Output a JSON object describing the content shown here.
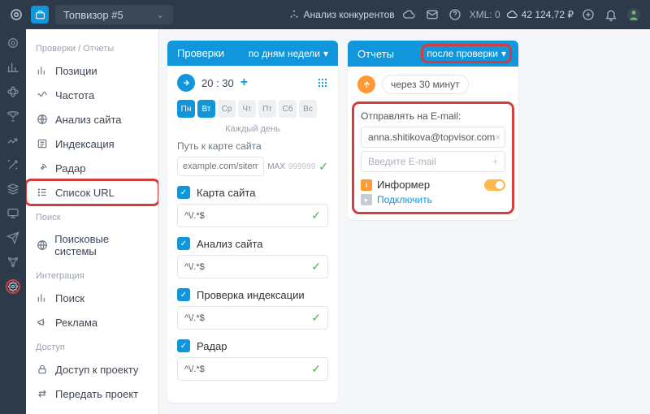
{
  "topbar": {
    "project_name": "Топвизор #5",
    "competitor_analysis": "Анализ конкурентов",
    "xml_label": "XML: 0",
    "balance": "42 124,72 ₽"
  },
  "sidebar": {
    "group1_heading": "Проверки / Отчеты",
    "items1": [
      {
        "label": "Позиции"
      },
      {
        "label": "Частота"
      },
      {
        "label": "Анализ сайта"
      },
      {
        "label": "Индексация"
      },
      {
        "label": "Радар"
      },
      {
        "label": "Список URL"
      }
    ],
    "group2_heading": "Поиск",
    "items2": [
      {
        "label": "Поисковые системы"
      }
    ],
    "group3_heading": "Интеграция",
    "items3": [
      {
        "label": "Поиск"
      },
      {
        "label": "Реклама"
      }
    ],
    "group4_heading": "Доступ",
    "items4": [
      {
        "label": "Доступ к проекту"
      },
      {
        "label": "Передать проект"
      }
    ]
  },
  "checks_panel": {
    "title": "Проверки",
    "schedule_mode": "по дням недели",
    "time": "20 : 30",
    "days": [
      "Пн",
      "Вт",
      "Ср",
      "Чт",
      "Пт",
      "Сб",
      "Вс"
    ],
    "days_active": [
      true,
      true,
      false,
      false,
      false,
      false,
      false
    ],
    "days_caption": "Каждый день",
    "sitemap_path_label": "Путь к карте сайта",
    "sitemap_placeholder": "example.com/sitem",
    "max_label": "MAX",
    "max_value": "999999",
    "sections": [
      {
        "label": "Карта сайта",
        "pattern": "^\\/.*$"
      },
      {
        "label": "Анализ сайта",
        "pattern": "^\\/.*$"
      },
      {
        "label": "Проверка индексации",
        "pattern": "^\\/.*$"
      },
      {
        "label": "Радар",
        "pattern": "^\\/.*$"
      }
    ]
  },
  "reports_panel": {
    "title": "Отчеты",
    "mode": "после проверки",
    "delay_text": "через 30 минут",
    "email_label": "Отправлять на E-mail:",
    "email_value": "anna.shitikova@topvisor.com",
    "email_placeholder": "Введите E-mail",
    "informer_label": "Информер",
    "connect_label": "Подключить"
  }
}
